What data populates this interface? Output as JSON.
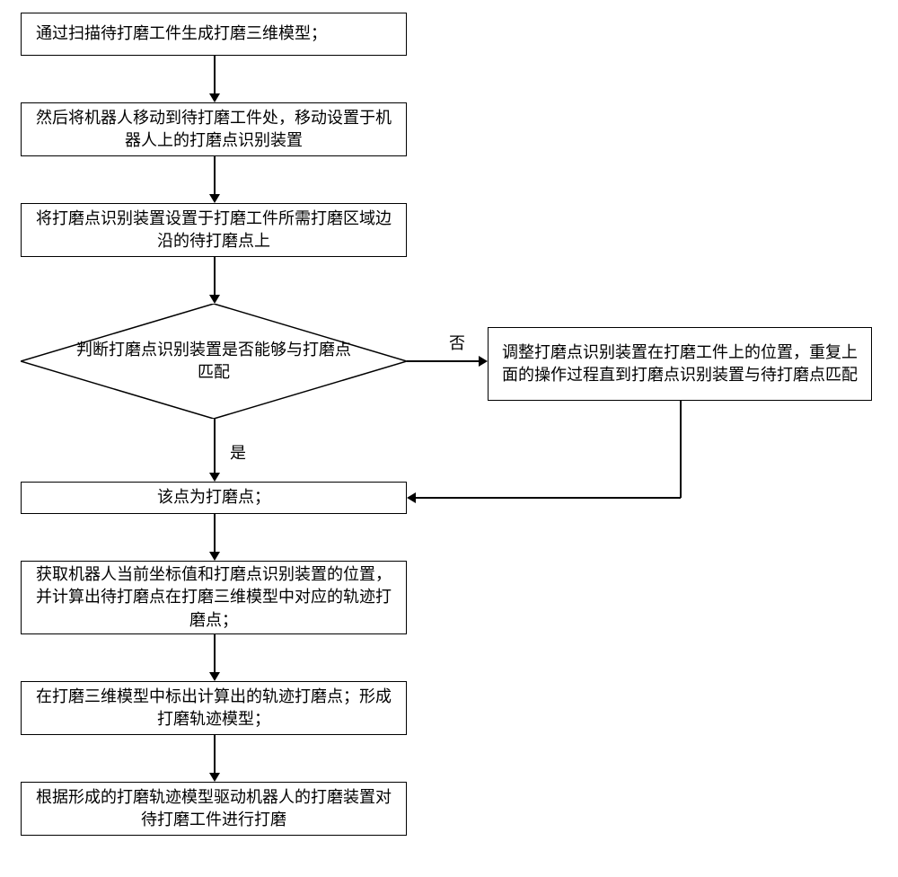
{
  "flowchart": {
    "step1": "通过扫描待打磨工件生成打磨三维模型；",
    "step2": "然后将机器人移动到待打磨工件处，移动设置于机器人上的打磨点识别装置",
    "step3": "将打磨点识别装置设置于打磨工件所需打磨区域边沿的待打磨点上",
    "decision": "判断打磨点识别装置是否能够与打磨点匹配",
    "no_label": "否",
    "yes_label": "是",
    "adjust": "调整打磨点识别装置在打磨工件上的位置，重复上面的操作过程直到打磨点识别装置与待打磨点匹配",
    "step4": "该点为打磨点；",
    "step5": "获取机器人当前坐标值和打磨点识别装置的位置，并计算出待打磨点在打磨三维模型中对应的轨迹打磨点；",
    "step6": "在打磨三维模型中标出计算出的轨迹打磨点；形成打磨轨迹模型；",
    "step7": "根据形成的打磨轨迹模型驱动机器人的打磨装置对待打磨工件进行打磨"
  }
}
